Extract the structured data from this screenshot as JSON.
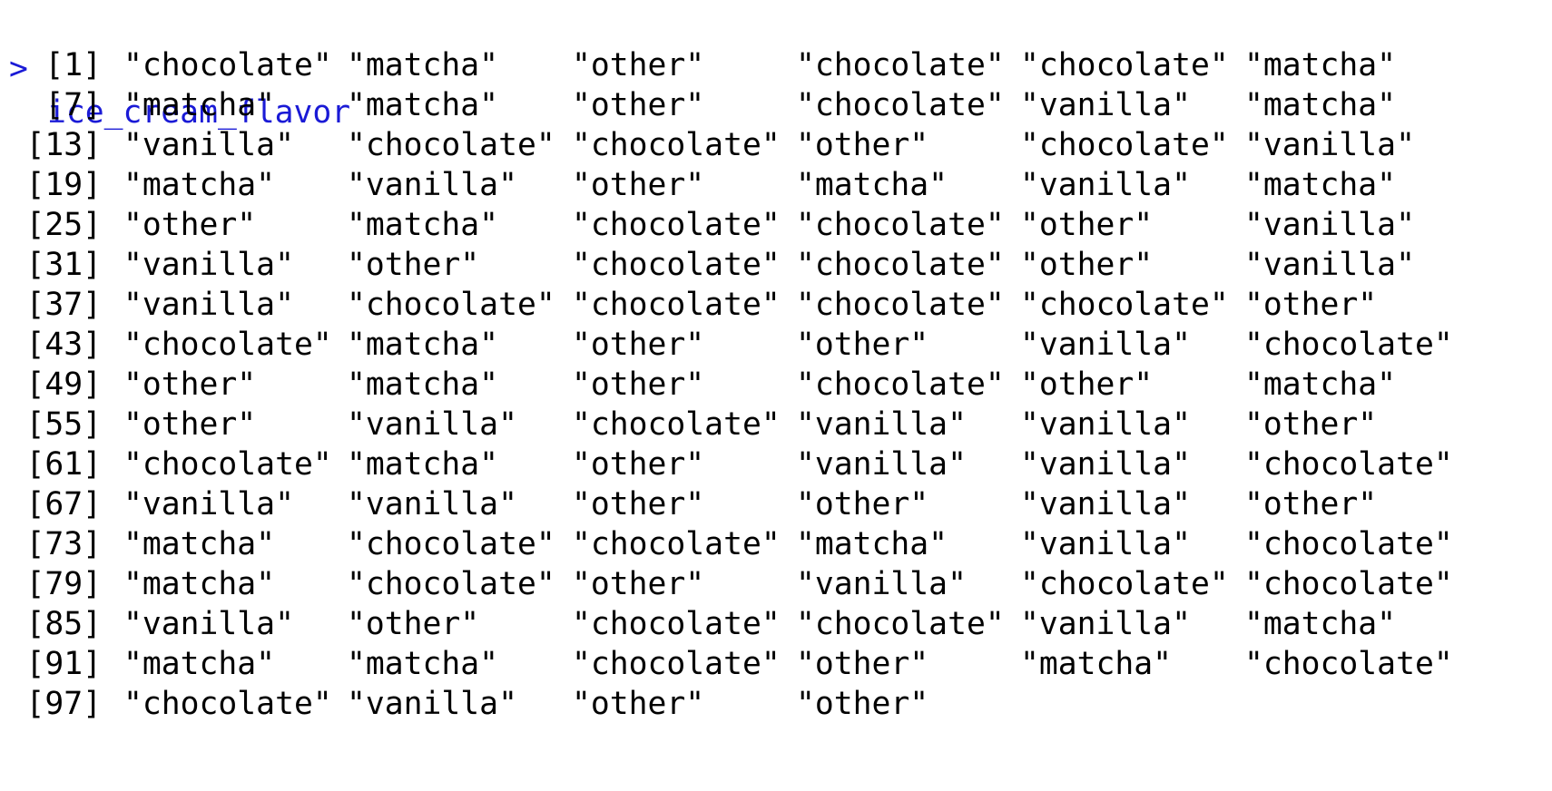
{
  "console": {
    "prompt_symbol": ">",
    "command": "ice_cream_flavor",
    "output": [
      {
        "index": "[1]",
        "values": [
          "\"chocolate\"",
          "\"matcha\"",
          "\"other\"",
          "\"chocolate\"",
          "\"chocolate\"",
          "\"matcha\""
        ]
      },
      {
        "index": "[7]",
        "values": [
          "\"matcha\"",
          "\"matcha\"",
          "\"other\"",
          "\"chocolate\"",
          "\"vanilla\"",
          "\"matcha\""
        ]
      },
      {
        "index": "[13]",
        "values": [
          "\"vanilla\"",
          "\"chocolate\"",
          "\"chocolate\"",
          "\"other\"",
          "\"chocolate\"",
          "\"vanilla\""
        ]
      },
      {
        "index": "[19]",
        "values": [
          "\"matcha\"",
          "\"vanilla\"",
          "\"other\"",
          "\"matcha\"",
          "\"vanilla\"",
          "\"matcha\""
        ]
      },
      {
        "index": "[25]",
        "values": [
          "\"other\"",
          "\"matcha\"",
          "\"chocolate\"",
          "\"chocolate\"",
          "\"other\"",
          "\"vanilla\""
        ]
      },
      {
        "index": "[31]",
        "values": [
          "\"vanilla\"",
          "\"other\"",
          "\"chocolate\"",
          "\"chocolate\"",
          "\"other\"",
          "\"vanilla\""
        ]
      },
      {
        "index": "[37]",
        "values": [
          "\"vanilla\"",
          "\"chocolate\"",
          "\"chocolate\"",
          "\"chocolate\"",
          "\"chocolate\"",
          "\"other\""
        ]
      },
      {
        "index": "[43]",
        "values": [
          "\"chocolate\"",
          "\"matcha\"",
          "\"other\"",
          "\"other\"",
          "\"vanilla\"",
          "\"chocolate\""
        ]
      },
      {
        "index": "[49]",
        "values": [
          "\"other\"",
          "\"matcha\"",
          "\"other\"",
          "\"chocolate\"",
          "\"other\"",
          "\"matcha\""
        ]
      },
      {
        "index": "[55]",
        "values": [
          "\"other\"",
          "\"vanilla\"",
          "\"chocolate\"",
          "\"vanilla\"",
          "\"vanilla\"",
          "\"other\""
        ]
      },
      {
        "index": "[61]",
        "values": [
          "\"chocolate\"",
          "\"matcha\"",
          "\"other\"",
          "\"vanilla\"",
          "\"vanilla\"",
          "\"chocolate\""
        ]
      },
      {
        "index": "[67]",
        "values": [
          "\"vanilla\"",
          "\"vanilla\"",
          "\"other\"",
          "\"other\"",
          "\"vanilla\"",
          "\"other\""
        ]
      },
      {
        "index": "[73]",
        "values": [
          "\"matcha\"",
          "\"chocolate\"",
          "\"chocolate\"",
          "\"matcha\"",
          "\"vanilla\"",
          "\"chocolate\""
        ]
      },
      {
        "index": "[79]",
        "values": [
          "\"matcha\"",
          "\"chocolate\"",
          "\"other\"",
          "\"vanilla\"",
          "\"chocolate\"",
          "\"chocolate\""
        ]
      },
      {
        "index": "[85]",
        "values": [
          "\"vanilla\"",
          "\"other\"",
          "\"chocolate\"",
          "\"chocolate\"",
          "\"vanilla\"",
          "\"matcha\""
        ]
      },
      {
        "index": "[91]",
        "values": [
          "\"matcha\"",
          "\"matcha\"",
          "\"chocolate\"",
          "\"other\"",
          "\"matcha\"",
          "\"chocolate\""
        ]
      },
      {
        "index": "[97]",
        "values": [
          "\"chocolate\"",
          "\"vanilla\"",
          "\"other\"",
          "\"other\""
        ]
      }
    ]
  },
  "colors": {
    "command_text": "#1a1ad6",
    "output_text": "#000000",
    "background": "#ffffff"
  }
}
